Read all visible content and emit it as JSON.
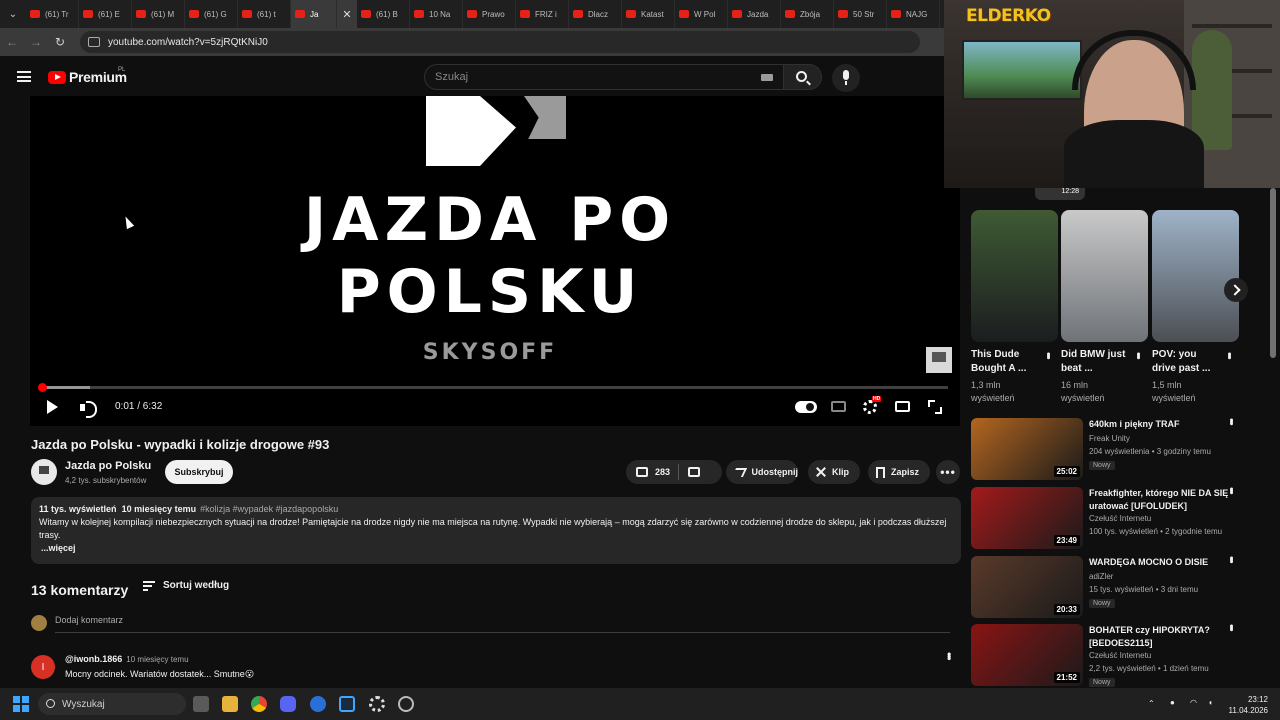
{
  "browser": {
    "tabs": [
      "(61) Tr",
      "(61) E",
      "(61) M",
      "(61) G",
      "(61) t",
      "Ja",
      "(61) B",
      "10 Na",
      "Prawo",
      "FRIZ i",
      "Dlacz",
      "Katast",
      "W Pol",
      "Jazda",
      "Zbója",
      "50 Str",
      "NAJG"
    ],
    "url": "youtube.com/watch?v=5zjRQtKNiJ0"
  },
  "header": {
    "logo_text": "Premium",
    "region": "PL",
    "search_placeholder": "Szukaj"
  },
  "player": {
    "thumb_title": "JAZDA PO\nPOLSKU",
    "thumb_author": "SKYSOFF",
    "time": "0:01 / 6:32",
    "progress_fraction": 0.003,
    "buffer_fraction": 0.053,
    "quality_badge": "HD"
  },
  "video": {
    "title": "Jazda po Polsku - wypadki i kolizje drogowe #93",
    "channel": "Jazda po Polsku",
    "subscribers": "4,2 tys. subskrybentów",
    "subscribe_label": "Subskrybuj",
    "likes": "283",
    "share_label": "Udostępnij",
    "clip_label": "Klip",
    "save_label": "Zapisz",
    "more_label": "•••"
  },
  "description": {
    "views": "11 tys. wyświetleń",
    "age": "10 miesięcy temu",
    "tags": "#kolizja #wypadek #jazdapopolsku",
    "text": "Witamy w kolejnej kompilacji niebezpiecznych sytuacji na drodze! Pamiętajcie na drodze nigdy nie ma miejsca na rutynę. Wypadki nie wybierają – mogą zdarzyć się zarówno w codziennej drodze do sklepu, jak i podczas dłuższej trasy.",
    "more": "...więcej"
  },
  "comments": {
    "count": "13 komentarzy",
    "sort_label": "Sortuj według",
    "add_placeholder": "Dodaj komentarz",
    "items": [
      {
        "initial": "I",
        "author": "@iwonb.1866",
        "time": "10 miesięcy temu",
        "text": "Mocny odcinek. Wariatów dostatek... Smutne😮"
      }
    ]
  },
  "webcam": {
    "logo": "ELDERKO"
  },
  "sidebar": {
    "partial_duration": "12:28",
    "shorts": [
      {
        "title": "This Dude Bought A ...",
        "views": "1,3 mln wyświetleń",
        "color_top": "#3f5a34",
        "color_bottom": "#1b1d1f"
      },
      {
        "title": "Did BMW just beat ...",
        "views": "16 mln wyświetleń",
        "color_top": "#c9c9c9",
        "color_bottom": "#6f7378"
      },
      {
        "title": "POV: you drive past ...",
        "views": "1,5 mln wyświetleń",
        "color_top": "#9fb3c8",
        "color_bottom": "#4c4f54"
      }
    ],
    "videos": [
      {
        "title": "640km i piękny TRAF",
        "channel": "Freak Unity",
        "stats": "204 wyświetlenia • 3 godziny temu",
        "badge": "Nowy",
        "duration": "25:02",
        "color": "#b4661f"
      },
      {
        "title": "Freakfighter, którego NIE DA SIĘ uratować [UFOLUDEK]",
        "channel": "Czełuść Internetu",
        "stats": "100 tys. wyświetleń • 2 tygodnie temu",
        "badge": "",
        "duration": "23:49",
        "color": "#a41a1a"
      },
      {
        "title": "WARDĘGA MOCNO O DISIE",
        "channel": "adiZler",
        "stats": "15 tys. wyświetleń • 3 dni temu",
        "badge": "Nowy",
        "duration": "20:33",
        "color": "#5a3a2a"
      },
      {
        "title": "BOHATER czy HIPOKRYTA? [BEDOES2115]",
        "channel": "Czełuść Internetu",
        "stats": "2,2 tys. wyświetleń • 1 dzień temu",
        "badge": "Nowy",
        "duration": "21:52",
        "color": "#8a1414"
      }
    ]
  },
  "taskbar": {
    "search_label": "Wyszukaj",
    "time": "23:12",
    "date": "11.04.2026"
  }
}
